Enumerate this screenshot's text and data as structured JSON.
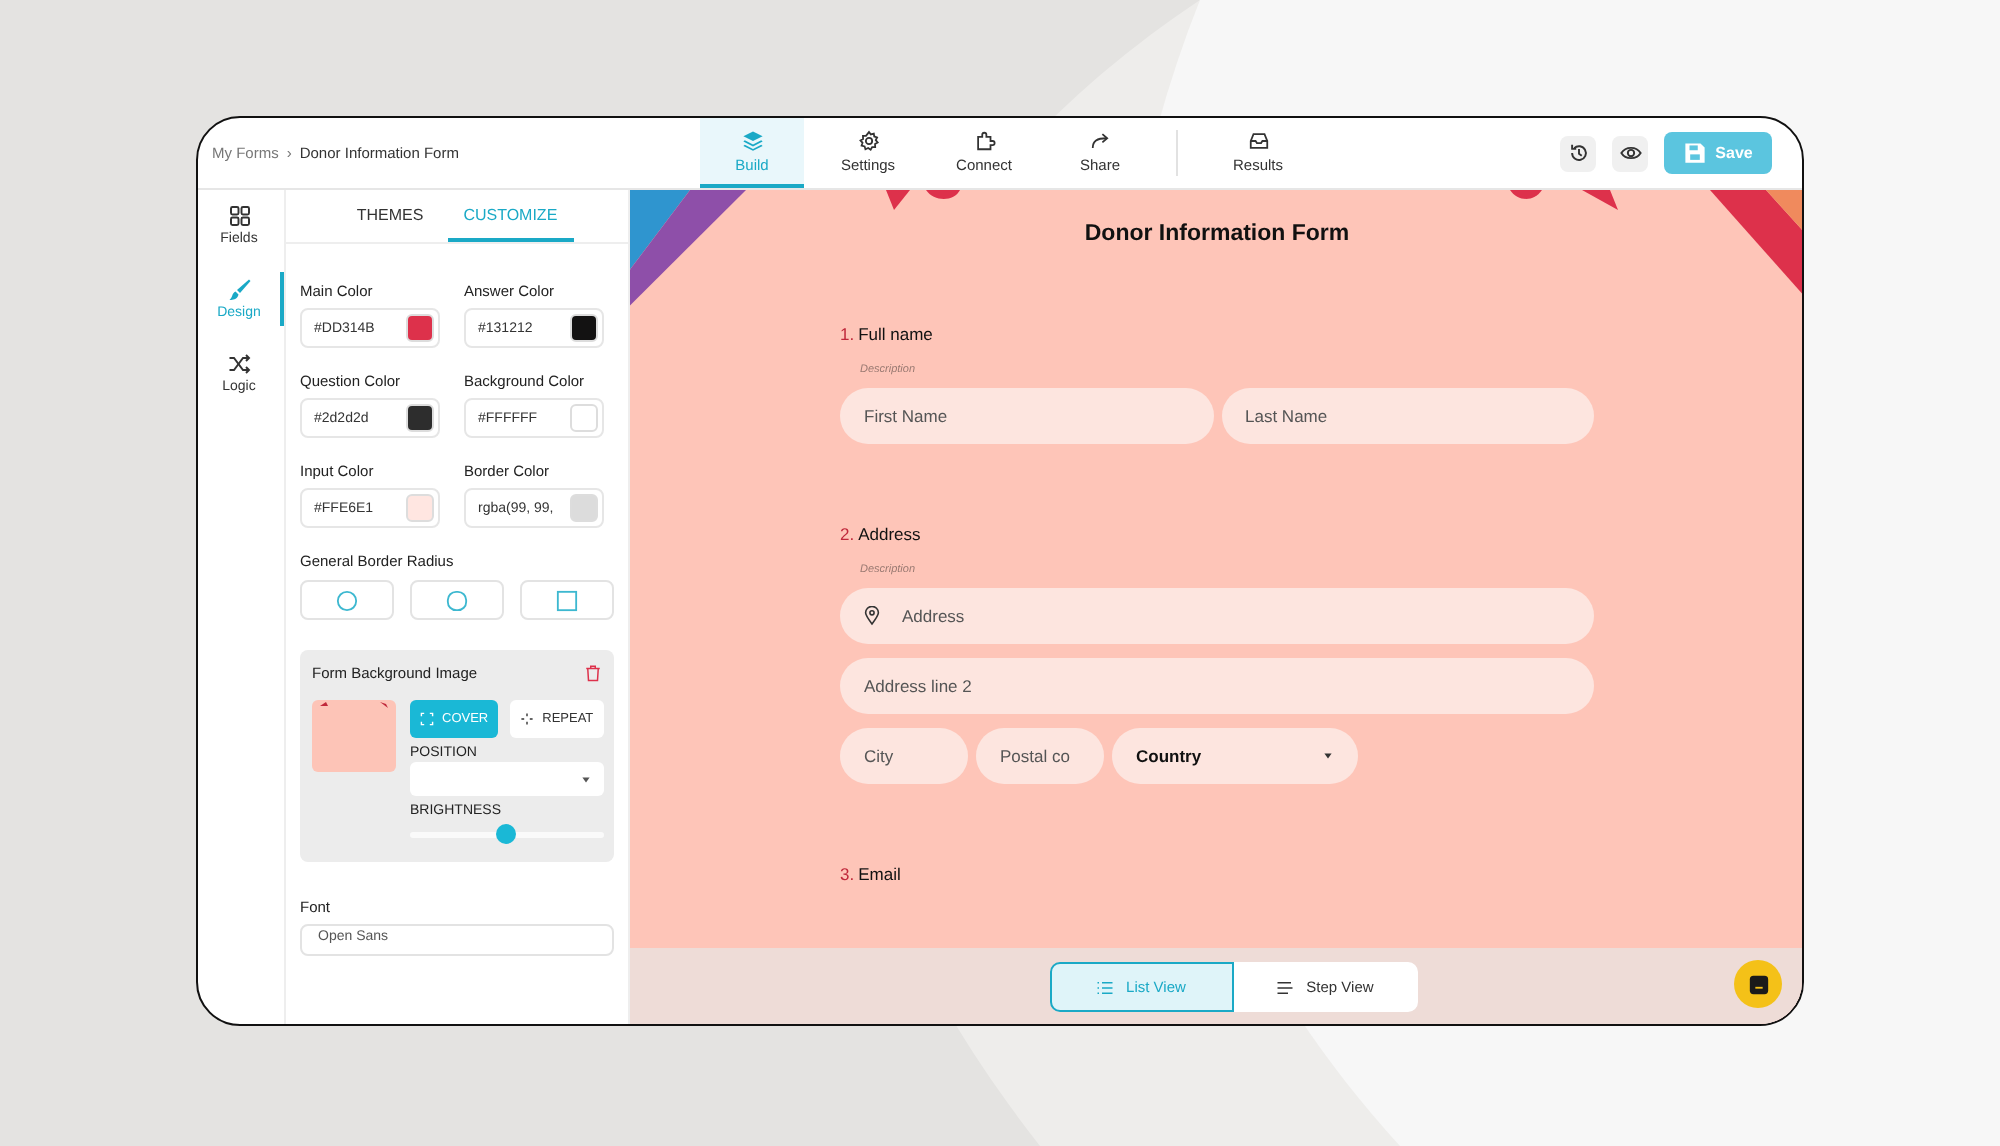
{
  "breadcrumb": {
    "parent": "My Forms",
    "separator": "›",
    "current": "Donor Information Form"
  },
  "nav_tabs": [
    {
      "label": "Build",
      "selected": true
    },
    {
      "label": "Settings",
      "selected": false
    },
    {
      "label": "Connect",
      "selected": false
    },
    {
      "label": "Share",
      "selected": false
    },
    {
      "label": "Results",
      "selected": false
    }
  ],
  "save_button": "Save",
  "rail": [
    {
      "label": "Fields",
      "selected": false
    },
    {
      "label": "Design",
      "selected": true
    },
    {
      "label": "Logic",
      "selected": false
    }
  ],
  "panel_tabs": [
    {
      "label": "THEMES",
      "selected": false
    },
    {
      "label": "CUSTOMIZE",
      "selected": true
    }
  ],
  "colors": [
    {
      "label": "Main Color",
      "value": "#DD314B",
      "color": "#dd314b"
    },
    {
      "label": "Answer Color",
      "value": "#131212",
      "color": "#131212"
    },
    {
      "label": "Question Color",
      "value": "#2d2d2d",
      "color": "#2d2d2d"
    },
    {
      "label": "Background Color",
      "value": "#FFFFFF",
      "color": "#ffffff"
    },
    {
      "label": "Input Color",
      "value": "#FFE6E1",
      "color": "#ffe6e1"
    },
    {
      "label": "Border Color",
      "value": "rgba(99, 99,",
      "color": "#dcdcdc"
    }
  ],
  "border_radius": {
    "label": "General Border Radius",
    "options": [
      {
        "kind": "circle"
      },
      {
        "kind": "rounded"
      },
      {
        "kind": "square"
      }
    ]
  },
  "background_image": {
    "title": "Form Background Image",
    "modes": [
      {
        "label": "COVER",
        "selected": true
      },
      {
        "label": "REPEAT",
        "selected": false
      }
    ],
    "position_label": "POSITION",
    "brightness_label": "BRIGHTNESS",
    "brightness": {
      "level": 0.5
    }
  },
  "font": {
    "label": "Font",
    "value": "Open Sans"
  },
  "form": {
    "title": "Donor Information Form",
    "questions": [
      {
        "number": "1.",
        "label": "Full name",
        "description": "Description",
        "rows": [
          [
            {
              "kind": "input",
              "placeholder": "First Name"
            },
            {
              "kind": "input",
              "placeholder": "Last Name"
            }
          ]
        ]
      },
      {
        "number": "2.",
        "label": "Address",
        "description": "Description",
        "rows": [
          [
            {
              "kind": "address",
              "placeholder": "Address"
            }
          ],
          [
            {
              "kind": "input",
              "placeholder": "Address line 2"
            }
          ],
          [
            {
              "kind": "small",
              "placeholder": "City"
            },
            {
              "kind": "small",
              "placeholder": "Postal co"
            },
            {
              "kind": "select",
              "value": "Country"
            }
          ]
        ]
      },
      {
        "number": "3.",
        "label": "Email"
      }
    ]
  },
  "view_toggle": [
    {
      "label": "List View",
      "selected": true
    },
    {
      "label": "Step View",
      "selected": false
    }
  ]
}
